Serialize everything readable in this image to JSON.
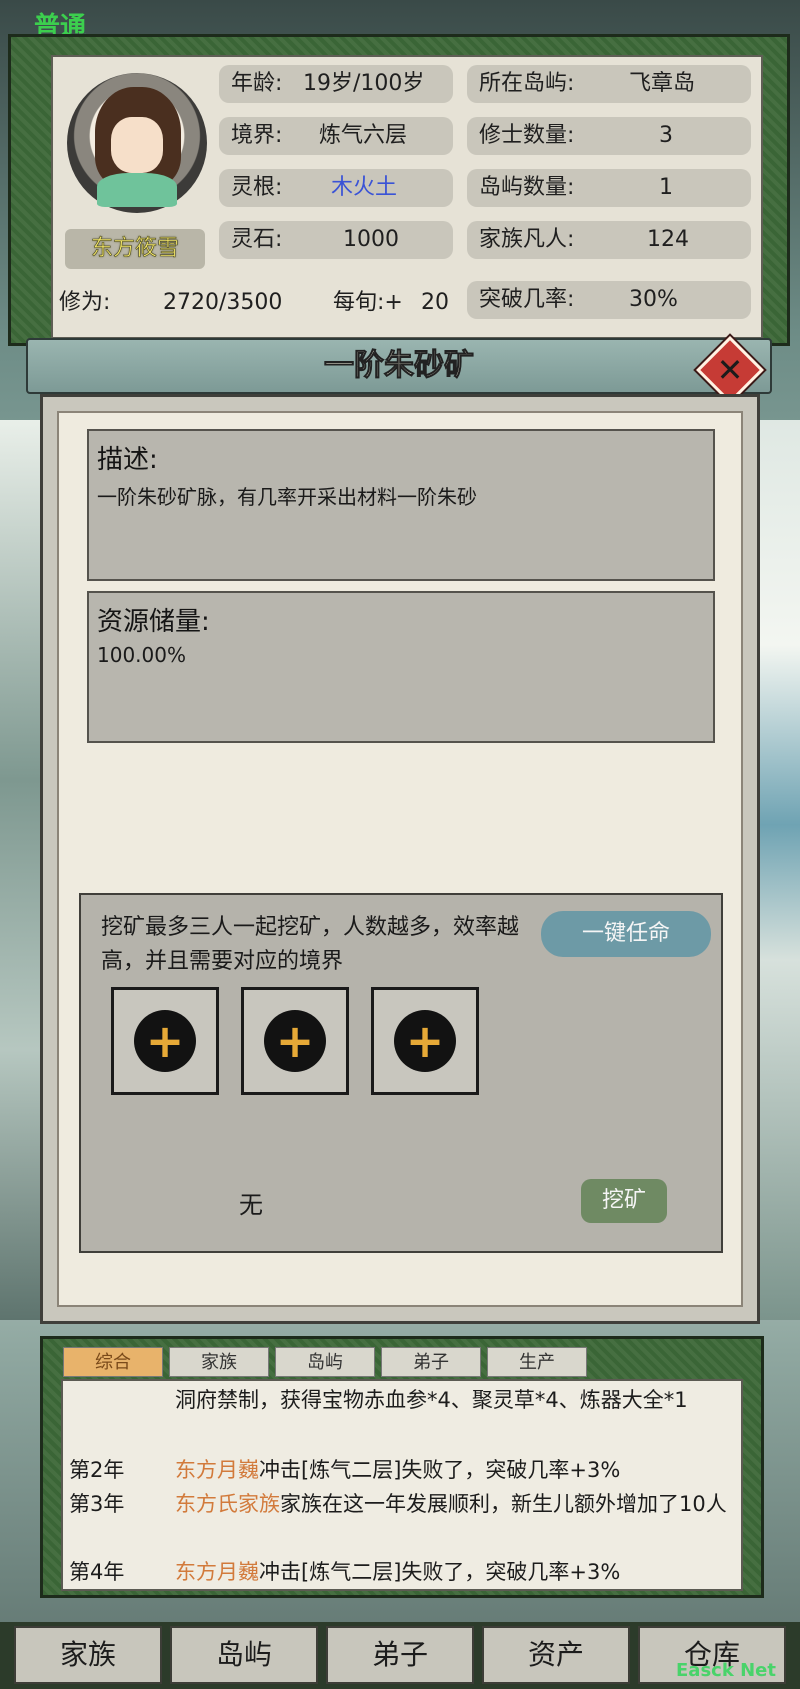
{
  "top_tag": "普通",
  "character": {
    "name": "东方筱雪",
    "stats": [
      {
        "label": "年龄:",
        "value": "19岁/100岁"
      },
      {
        "label": "境界:",
        "value": "炼气六层"
      },
      {
        "label": "灵根:",
        "value": "木火土"
      },
      {
        "label": "灵石:",
        "value": "1000"
      },
      {
        "label": "所在岛屿:",
        "value": "飞章岛"
      },
      {
        "label": "修士数量:",
        "value": "3"
      },
      {
        "label": "岛屿数量:",
        "value": "1"
      },
      {
        "label": "家族凡人:",
        "value": "124"
      },
      {
        "label": "突破几率:",
        "value": "30%"
      }
    ],
    "cultivation": {
      "label": "修为:",
      "value": "2720/3500",
      "rate_label": "每旬:+",
      "rate_value": "20"
    }
  },
  "dialog": {
    "title": "一阶朱砂矿",
    "description_label": "描述:",
    "description_text": "一阶朱砂矿脉，有几率开采出材料一阶朱砂",
    "reserve_label": "资源储量:",
    "reserve_value": "100.00%",
    "task_text": "挖矿最多三人一起挖矿，人数越多，效率越高，并且需要对应的境界",
    "assign_button": "一键任命",
    "slot_icon": "plus-icon",
    "assignee": "无",
    "mine_button": "挖矿"
  },
  "log": {
    "tabs": [
      "综合",
      "家族",
      "岛屿",
      "弟子",
      "生产"
    ],
    "entries": [
      {
        "year": "",
        "highlight": "",
        "text": "洞府禁制，获得宝物赤血参*4、聚灵草*4、炼器大全*1"
      },
      {
        "year": "第2年",
        "highlight": "东方月巍",
        "text": "冲击[炼气二层]失败了，突破几率+3%"
      },
      {
        "year": "第3年",
        "highlight": "东方氏家族",
        "text": "家族在这一年发展顺利，新生儿额外增加了10人"
      },
      {
        "year": "第4年",
        "highlight": "东方月巍",
        "text": "冲击[炼气二层]失败了，突破几率+3%"
      }
    ]
  },
  "nav": [
    "家族",
    "岛屿",
    "弟子",
    "资产",
    "仓库"
  ],
  "watermark": "Easck Net",
  "colors": {
    "highlight": "#d27a3b",
    "linggen": "#3a53d6",
    "close": "#c63b35"
  }
}
